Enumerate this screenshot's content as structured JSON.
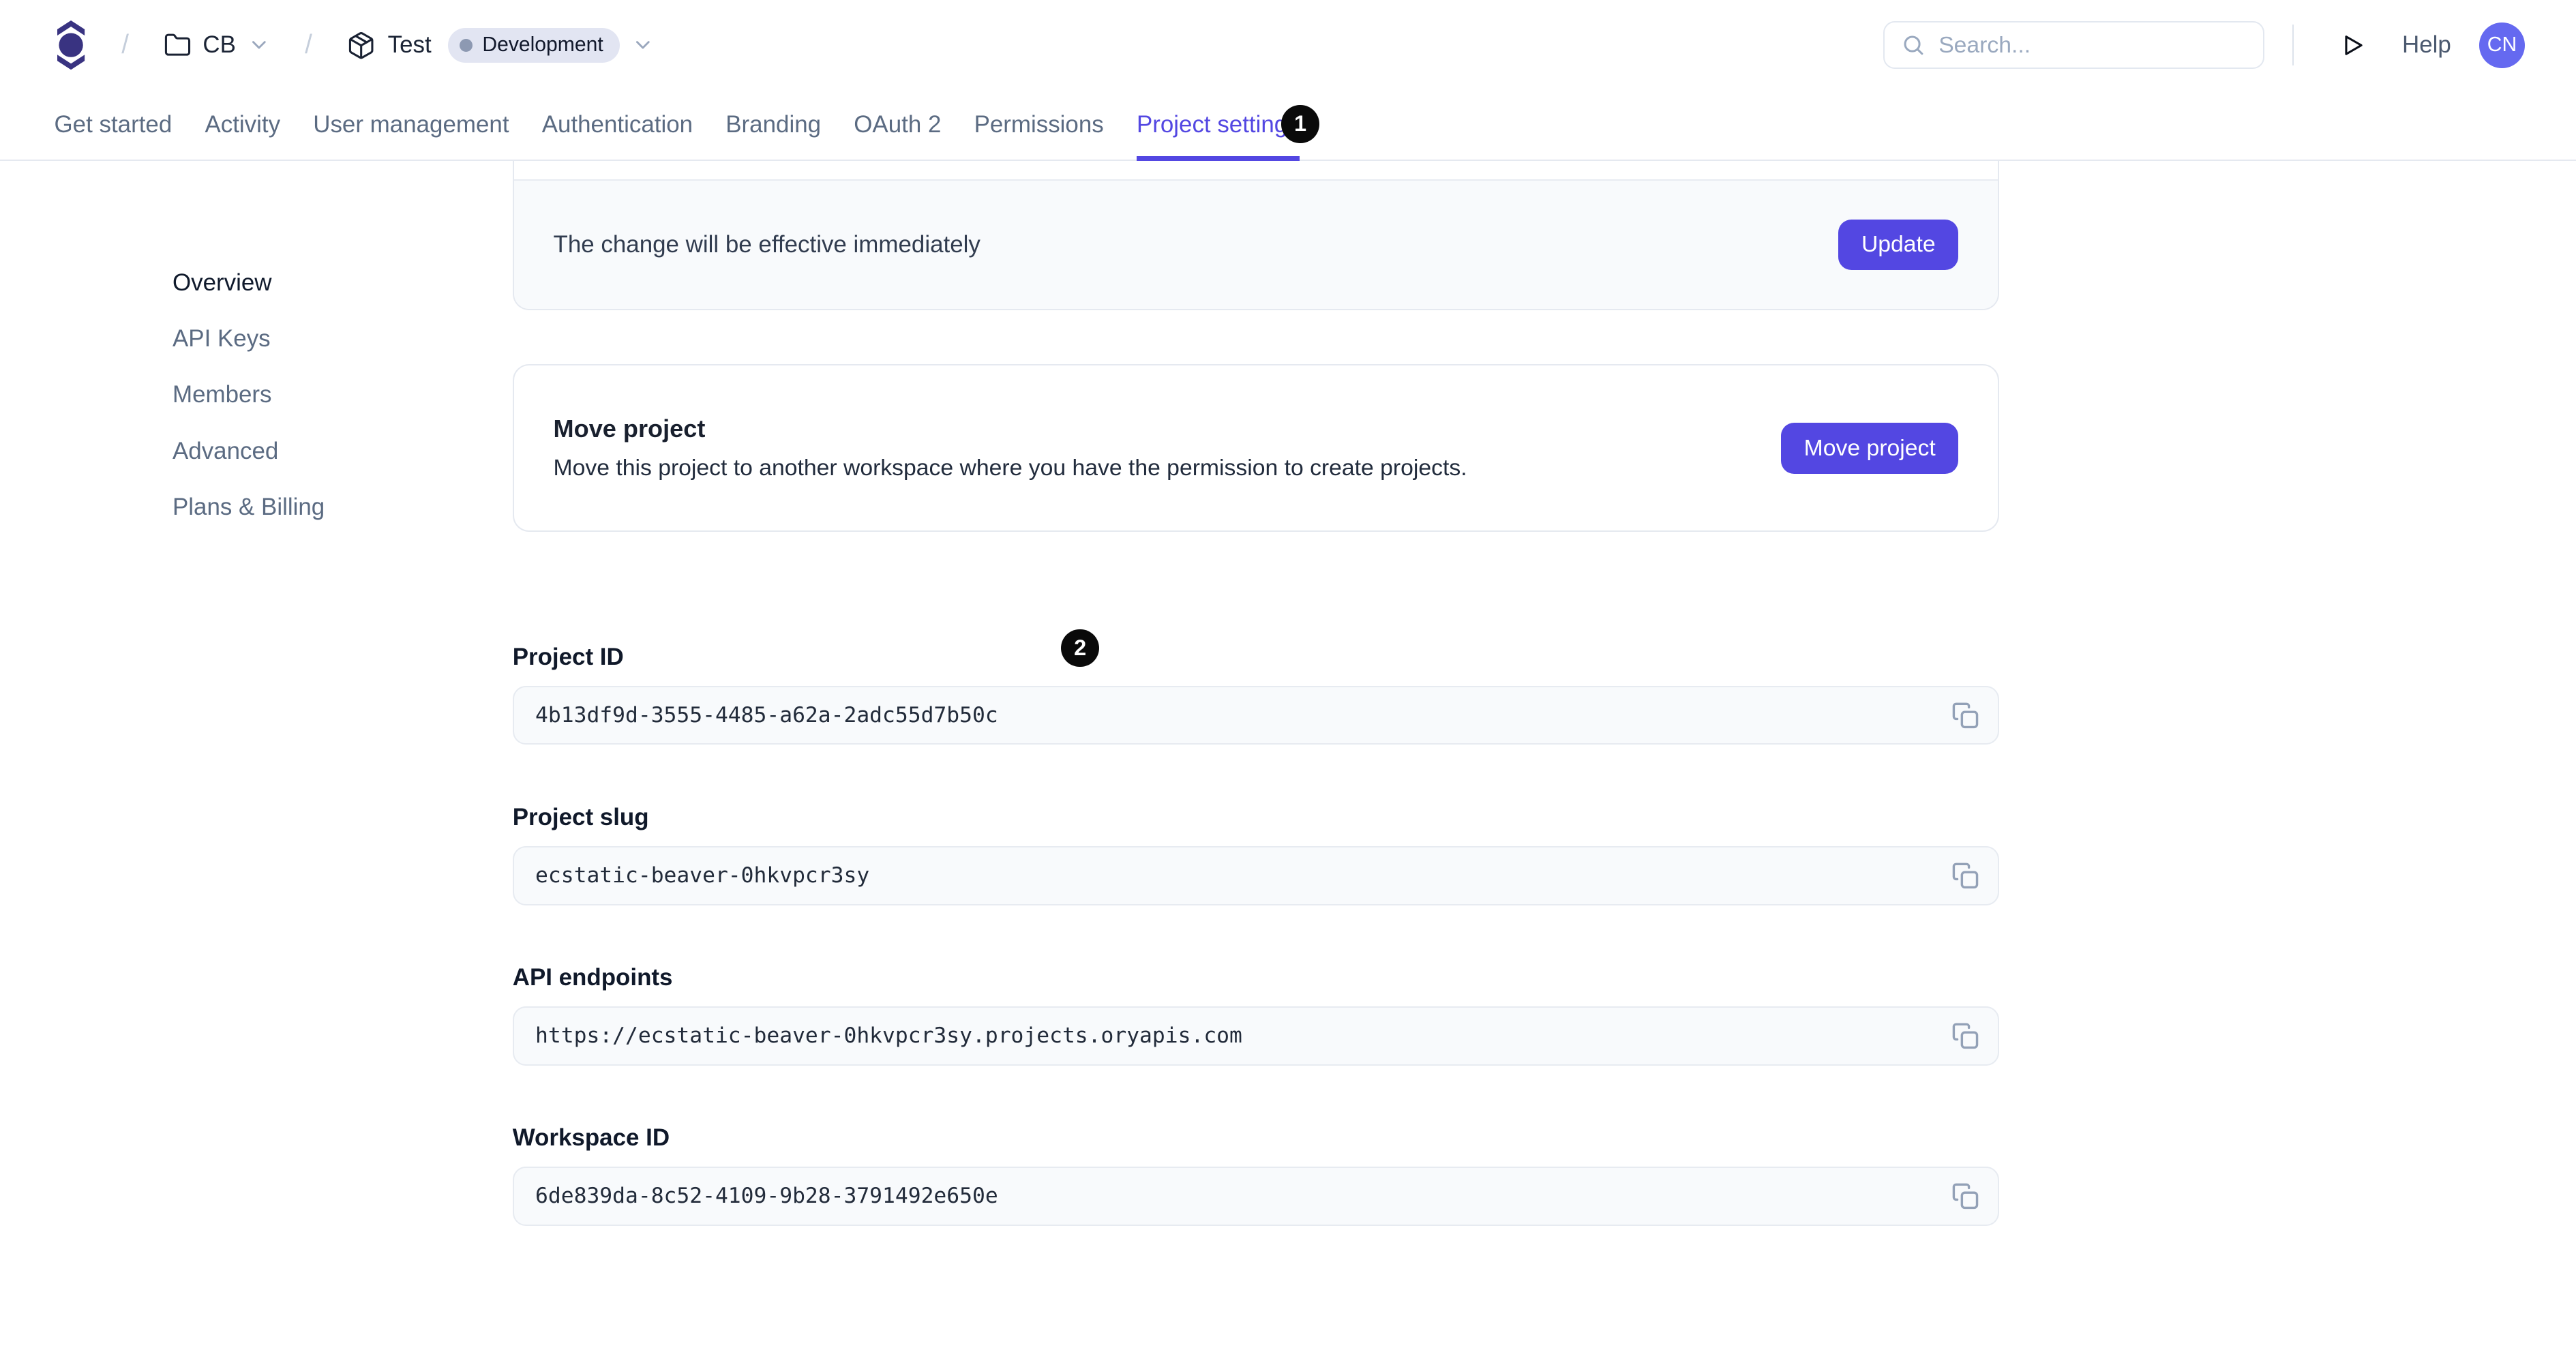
{
  "header": {
    "breadcrumb": {
      "workspace": "CB",
      "project": "Test",
      "environment": "Development"
    },
    "search": {
      "placeholder": "Search..."
    },
    "help": "Help",
    "avatar": "CN"
  },
  "tabs": [
    {
      "label": "Get started"
    },
    {
      "label": "Activity"
    },
    {
      "label": "User management"
    },
    {
      "label": "Authentication"
    },
    {
      "label": "Branding"
    },
    {
      "label": "OAuth 2"
    },
    {
      "label": "Permissions"
    },
    {
      "label": "Project settings",
      "active": true
    }
  ],
  "annotations": [
    {
      "label": "1"
    },
    {
      "label": "2"
    }
  ],
  "sidebar": {
    "items": [
      {
        "label": "Overview",
        "active": true
      },
      {
        "label": "API Keys"
      },
      {
        "label": "Members"
      },
      {
        "label": "Advanced"
      },
      {
        "label": "Plans & Billing"
      }
    ]
  },
  "main": {
    "update_card": {
      "note": "The change will be effective immediately",
      "button": "Update"
    },
    "move_card": {
      "title": "Move project",
      "description": "Move this project to another workspace where you have the permission to create projects.",
      "button": "Move project"
    },
    "fields": [
      {
        "label": "Project ID",
        "value": "4b13df9d-3555-4485-a62a-2adc55d7b50c"
      },
      {
        "label": "Project slug",
        "value": "ecstatic-beaver-0hkvpcr3sy"
      },
      {
        "label": "API endpoints",
        "value": "https://ecstatic-beaver-0hkvpcr3sy.projects.oryapis.com"
      },
      {
        "label": "Workspace ID",
        "value": "6de839da-8c52-4109-9b28-3791492e650e"
      }
    ]
  },
  "colors": {
    "accent": "#5347e2",
    "logo": "#393381",
    "avatar_bg": "#6569f0",
    "marker_bg": "#0a0a0a",
    "environment_badge_bg": "#e2e5f2",
    "environment_dot": "#8d99b2"
  }
}
